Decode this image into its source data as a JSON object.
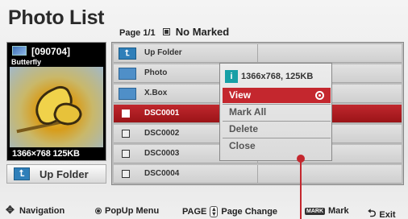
{
  "title": "Photo List",
  "page_info": {
    "page": "Page 1/1",
    "marked": "No Marked"
  },
  "preview": {
    "filename": "[090704]",
    "caption": "Butterfly",
    "resolution": "1366×768  125KB"
  },
  "up_folder_button": {
    "label": "Up Folder"
  },
  "list": {
    "rows": [
      {
        "label": "Up Folder",
        "icon": "up-folder-icon"
      },
      {
        "label": "Photo",
        "icon": "folder-icon"
      },
      {
        "label": "X.Box",
        "icon": "folder-icon"
      },
      {
        "label": "DSC0001",
        "icon": "checkbox-icon",
        "selected": true
      },
      {
        "label": "DSC0002",
        "icon": "checkbox-icon"
      },
      {
        "label": "DSC0003",
        "icon": "checkbox-icon"
      },
      {
        "label": "DSC0004",
        "icon": "checkbox-icon"
      }
    ]
  },
  "popup": {
    "info_badge": "i",
    "info": "1366x768, 125KB",
    "items": [
      "View",
      "Mark All",
      "Delete",
      "Close"
    ],
    "selected": "View"
  },
  "footer": {
    "navigation": "Navigation",
    "popup_menu": "PopUp Menu",
    "page": "PAGE",
    "page_change": "Page Change",
    "mark_key": "MARK",
    "mark": "Mark",
    "exit": "Exit"
  },
  "colors": {
    "accent": "#c4272e",
    "info_teal": "#17a0a6",
    "folder_blue": "#2f7fb9"
  }
}
